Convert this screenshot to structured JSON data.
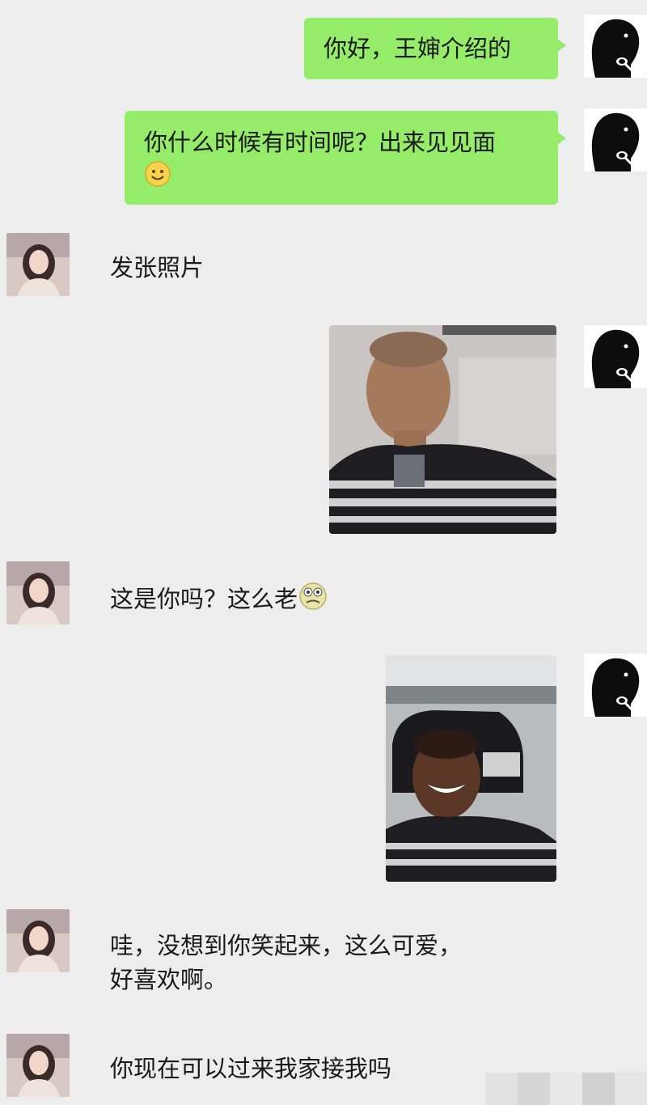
{
  "colors": {
    "background": "#ededed",
    "sent_bubble": "#95ec69",
    "text": "#1a1a1a"
  },
  "messages": [
    {
      "side": "right",
      "type": "text",
      "text": "你好，王婶介绍的"
    },
    {
      "side": "right",
      "type": "text",
      "text": "你什么时候有时间呢？出来见见面",
      "emoji": "smile-emoji"
    },
    {
      "side": "left",
      "type": "text",
      "text": "发张照片"
    },
    {
      "side": "right",
      "type": "image",
      "content": "selfie-photo"
    },
    {
      "side": "left",
      "type": "text",
      "text": "这是你吗？这么老",
      "emoji": "shocked-emoji"
    },
    {
      "side": "right",
      "type": "image",
      "content": "smiling-selfie-with-car-photo"
    },
    {
      "side": "left",
      "type": "text",
      "lines": [
        "哇，没想到你笑起来，这么可爱，",
        "好喜欢啊。"
      ]
    },
    {
      "side": "left",
      "type": "text",
      "text": "你现在可以过来我家接我吗"
    }
  ]
}
